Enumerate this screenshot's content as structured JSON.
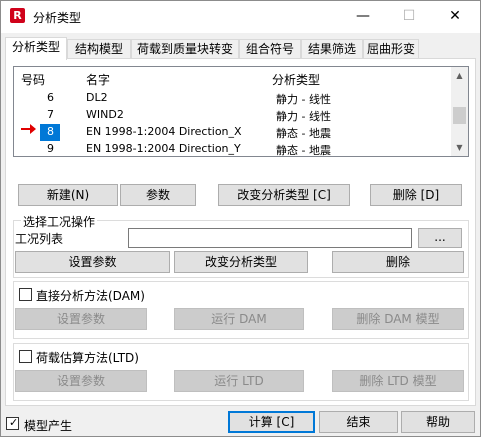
{
  "window": {
    "title": "分析类型",
    "app_icon_letter": "R",
    "controls": {
      "minimize": "—",
      "maximize": "☐",
      "close": "✕"
    }
  },
  "tabs": [
    {
      "label": "分析类型",
      "active": true
    },
    {
      "label": "结构模型",
      "active": false
    },
    {
      "label": "荷载到质量块转变",
      "active": false
    },
    {
      "label": "组合符号",
      "active": false
    },
    {
      "label": "结果筛选",
      "active": false
    },
    {
      "label": "屈曲形变",
      "active": false
    }
  ],
  "list": {
    "columns": {
      "number": "号码",
      "name": "名字",
      "type": "分析类型"
    },
    "rows": [
      {
        "number": "6",
        "name": "DL2",
        "type": "静力 - 线性",
        "selected": false
      },
      {
        "number": "7",
        "name": "WIND2",
        "type": "静力 - 线性",
        "selected": false
      },
      {
        "number": "8",
        "name": "EN 1998-1:2004 Direction_X",
        "type": "静态 - 地震",
        "selected": true
      },
      {
        "number": "9",
        "name": "EN 1998-1:2004 Direction_Y",
        "type": "静态 - 地震",
        "selected": false
      }
    ],
    "scroll": {
      "up": "▲",
      "down": "▼"
    }
  },
  "list_buttons": {
    "new": "新建(N)",
    "params": "参数",
    "change_type": "改变分析类型 [C]",
    "delete": "删除 [D]"
  },
  "case_ops": {
    "title": "选择工况操作",
    "case_list_label": "工况列表",
    "case_list_value": "",
    "browse": "...",
    "set_params": "设置参数",
    "change_type": "改变分析类型",
    "delete": "删除"
  },
  "dam": {
    "checkbox_label": "直接分析方法(DAM)",
    "checked": false,
    "set_params": "设置参数",
    "run": "运行 DAM",
    "delete_model": "删除 DAM 模型"
  },
  "ltd": {
    "checkbox_label": "荷载估算方法(LTD)",
    "checked": false,
    "set_params": "设置参数",
    "run": "运行 LTD",
    "delete_model": "删除 LTD 模型"
  },
  "footer": {
    "model_gen_label": "模型产生",
    "model_gen_checked": true,
    "checkmark": "✓",
    "calculate": "计算 [C]",
    "close": "结束",
    "help": "帮助"
  },
  "colors": {
    "selection": "#0078d7",
    "arrow": "#e00000",
    "app_icon": "#d0021b"
  }
}
